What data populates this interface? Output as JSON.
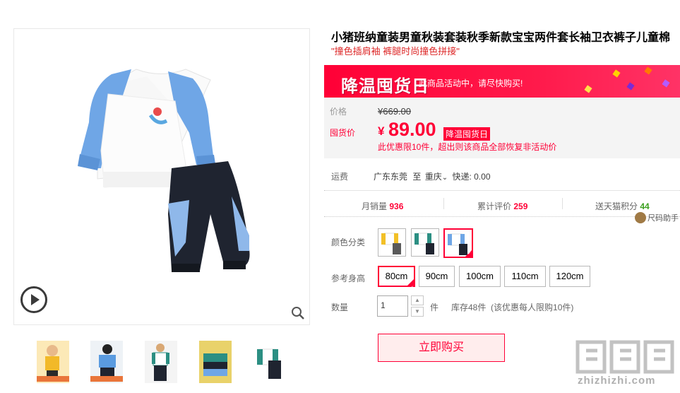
{
  "product": {
    "title": "小猪班纳童装男童秋装套装秋季新款宝宝两件套长袖卫衣裤子儿童棉",
    "subtitle": "\"撞色插肩袖 裤腿时尚撞色拼接\""
  },
  "promo": {
    "banner_title": "降温囤货日",
    "banner_sub": "此商品活动中，请尽快购买!",
    "price_label": "价格",
    "original_price": "¥669.00",
    "promo_label": "囤货价",
    "currency": "¥",
    "promo_price": "89.00",
    "promo_tag": "降温囤货日",
    "limit_note": "此优惠限10件，超出则该商品全部恢复非活动价"
  },
  "shipping": {
    "label": "运费",
    "from": "广东东莞",
    "to_word": "至",
    "to": "重庆",
    "express": "快递: 0.00"
  },
  "stats": {
    "monthly_label": "月销量",
    "monthly_value": "936",
    "reviews_label": "累计评价",
    "reviews_value": "259",
    "points_label": "送天猫积分",
    "points_value": "44"
  },
  "helper": {
    "label": "尺码助手"
  },
  "options": {
    "color_label": "颜色分类",
    "size_label": "参考身高",
    "sizes": [
      "80cm",
      "90cm",
      "100cm",
      "110cm",
      "120cm"
    ],
    "selected_size": "80cm"
  },
  "quantity": {
    "label": "数量",
    "value": "1",
    "unit": "件",
    "stock": "库存48件",
    "stock_note": "(该优惠每人限购10件)"
  },
  "buy_button": {
    "label": "立即购买"
  },
  "watermark": {
    "text": "zhizhizhi.com"
  },
  "colors": {
    "accent": "#ff0036",
    "banner": "#ff0036",
    "points_green": "#3a9f1e"
  }
}
